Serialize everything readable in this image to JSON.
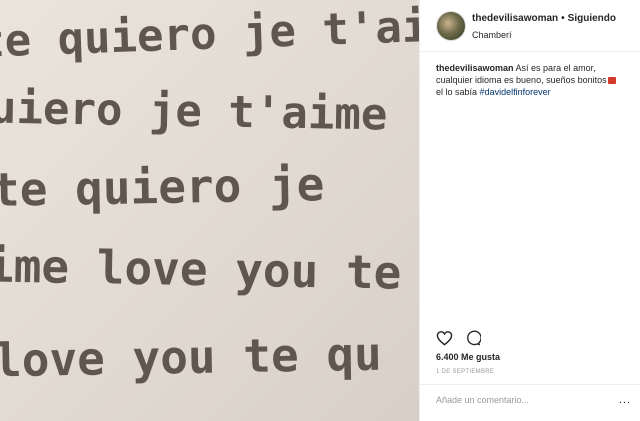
{
  "photo": {
    "lines": [
      "te quiero je t'aime",
      "uiero je t'aime",
      "te quiero je",
      "ime love you te",
      "love you te qu"
    ]
  },
  "post": {
    "username": "thedevilisawoman",
    "separator": "•",
    "follow_status": "Siguiendo",
    "location": "Chamberí",
    "caption_user": "thedevilisawoman",
    "caption_text": "Así es para el amor, cualquier idioma es bueno, sueños bonitos",
    "caption_text2": "el lo sabía",
    "hashtag": "#davidelfinforever",
    "likes": "6.400 Me gusta",
    "date": "1 DE SEPTIEMBRE"
  },
  "comment": {
    "placeholder": "Añade un comentario...",
    "more": "..."
  },
  "icons": {
    "like": "heart-icon",
    "comment": "comment-bubble-icon"
  },
  "colors": {
    "link": "#003569",
    "text": "#262626",
    "muted": "#999999",
    "divider": "#efefef"
  }
}
